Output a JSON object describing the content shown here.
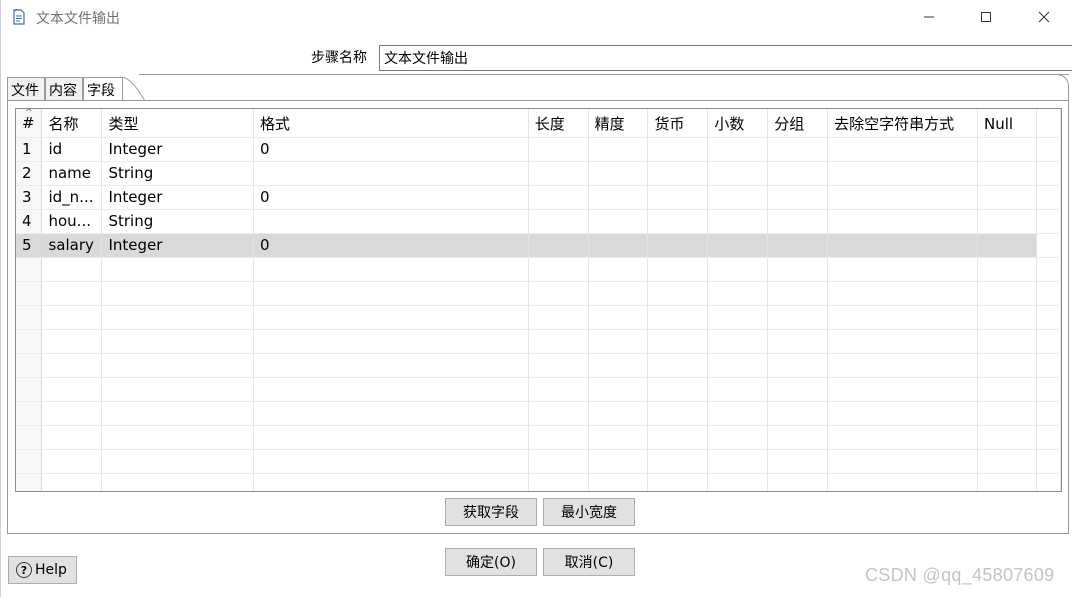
{
  "window": {
    "title": "文本文件输出",
    "icon": "document-icon"
  },
  "step": {
    "label": "步骤名称",
    "value": "文本文件输出"
  },
  "tabs": [
    {
      "label": "文件",
      "active": false
    },
    {
      "label": "内容",
      "active": false
    },
    {
      "label": "字段",
      "active": true
    }
  ],
  "table": {
    "columns": [
      "#",
      "名称",
      "类型",
      "格式",
      "长度",
      "精度",
      "货币",
      "小数",
      "分组",
      "去除空字符串方式",
      "Null"
    ],
    "rows": [
      [
        "1",
        "id",
        "Integer",
        "0",
        "",
        "",
        "",
        "",
        "",
        "",
        ""
      ],
      [
        "2",
        "name",
        "String",
        "",
        "",
        "",
        "",
        "",
        "",
        "",
        ""
      ],
      [
        "3",
        "id_n...",
        "Integer",
        "0",
        "",
        "",
        "",
        "",
        "",
        "",
        ""
      ],
      [
        "4",
        "hou...",
        "String",
        "",
        "",
        "",
        "",
        "",
        "",
        "",
        ""
      ],
      [
        "5",
        "salary",
        "Integer",
        "0",
        "",
        "",
        "",
        "",
        "",
        "",
        ""
      ]
    ],
    "selected_row": 5
  },
  "buttons": {
    "get_fields": "获取字段",
    "min_width": "最小宽度",
    "ok": "确定(O)",
    "cancel": "取消(C)",
    "help": "Help"
  },
  "watermark": "CSDN @qq_45807609"
}
